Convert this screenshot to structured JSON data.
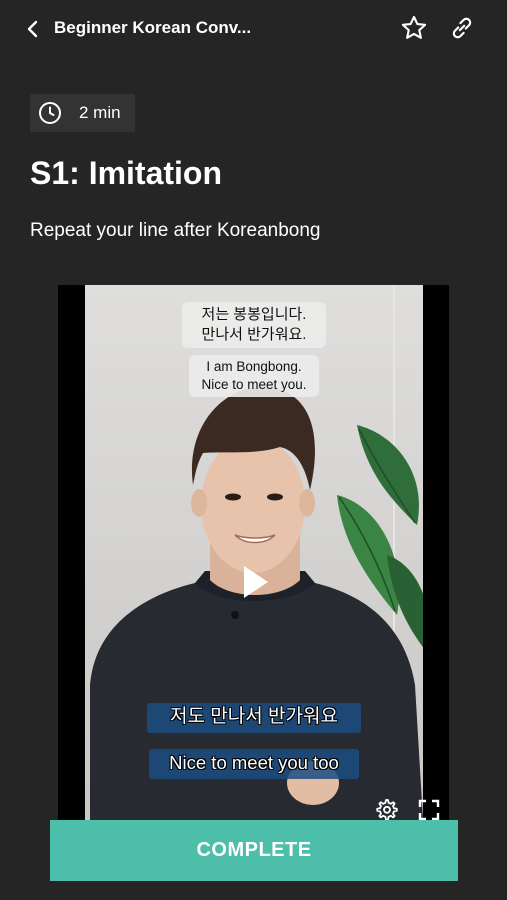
{
  "header": {
    "title": "Beginner Korean Conv...",
    "back_icon": "chevron-left-icon",
    "favorite_icon": "star-icon",
    "share_icon": "link-icon"
  },
  "lesson": {
    "duration": "2 min",
    "title": "S1: Imitation",
    "instruction": "Repeat your line after Koreanbong"
  },
  "video": {
    "caption_korean_lines": [
      "저는 봉봉입니다.",
      "만나서 반가워요."
    ],
    "caption_english_lines": [
      "I am Bongbong.",
      "Nice to meet you."
    ],
    "subtitle_korean": "저도 만나서 반가워요",
    "subtitle_english": "Nice to meet you too",
    "play_icon": "play-icon",
    "settings_icon": "gear-icon",
    "fullscreen_icon": "fullscreen-icon"
  },
  "actions": {
    "complete_label": "COMPLETE"
  },
  "colors": {
    "background": "#252525",
    "accent": "#4cbea9",
    "badge_bg": "#333333",
    "subtitle_bg": "#1c4e82"
  }
}
